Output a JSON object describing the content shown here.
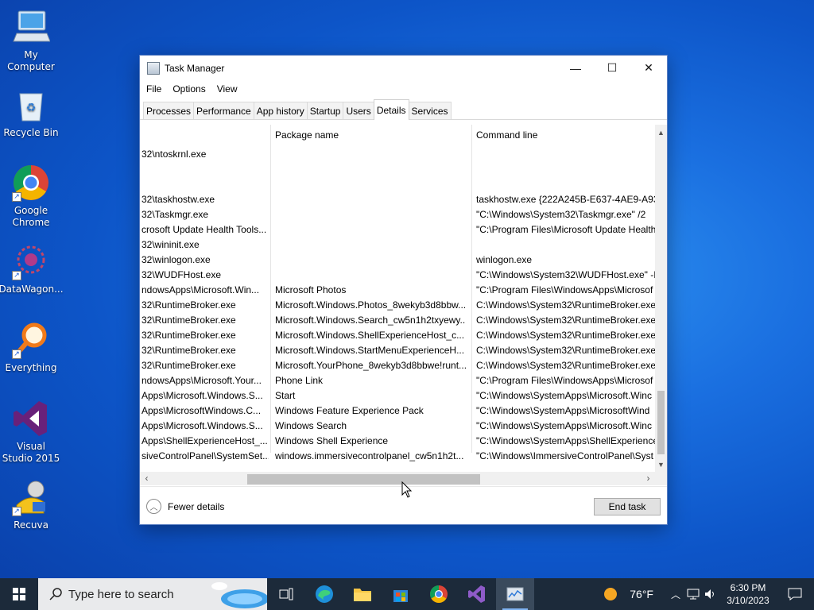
{
  "desktop": {
    "icons": [
      {
        "label": "My Computer"
      },
      {
        "label": "Recycle Bin"
      },
      {
        "label": "Google Chrome"
      },
      {
        "label": "DataWagon..."
      },
      {
        "label": "Everything"
      },
      {
        "label": "Visual Studio 2015"
      },
      {
        "label": "Recuva"
      }
    ]
  },
  "window": {
    "title": "Task Manager",
    "controls": {
      "minimize": "—",
      "maximize": "☐",
      "close": "✕"
    },
    "menu": [
      "File",
      "Options",
      "View"
    ],
    "tabs": [
      "Processes",
      "Performance",
      "App history",
      "Startup",
      "Users",
      "Details",
      "Services"
    ],
    "active_tab": "Details",
    "columns": [
      "",
      "Package name",
      "Command line"
    ],
    "rows": [
      {
        "path": "32\\ntoskrnl.exe",
        "package": "",
        "cmd": ""
      },
      {
        "path": "",
        "package": "",
        "cmd": ""
      },
      {
        "path": "",
        "package": "",
        "cmd": ""
      },
      {
        "path": "32\\taskhostw.exe",
        "package": "",
        "cmd": "taskhostw.exe {222A245B-E637-4AE9-A93F"
      },
      {
        "path": "32\\Taskmgr.exe",
        "package": "",
        "cmd": "\"C:\\Windows\\System32\\Taskmgr.exe\" /2"
      },
      {
        "path": "crosoft Update Health Tools...",
        "package": "",
        "cmd": "\"C:\\Program Files\\Microsoft Update Health"
      },
      {
        "path": "32\\wininit.exe",
        "package": "",
        "cmd": ""
      },
      {
        "path": "32\\winlogon.exe",
        "package": "",
        "cmd": "winlogon.exe"
      },
      {
        "path": "32\\WUDFHost.exe",
        "package": "",
        "cmd": "\"C:\\Windows\\System32\\WUDFHost.exe\" -I"
      },
      {
        "path": "ndowsApps\\Microsoft.Win...",
        "package": "Microsoft Photos",
        "cmd": "\"C:\\Program Files\\WindowsApps\\Microsof"
      },
      {
        "path": "32\\RuntimeBroker.exe",
        "package": "Microsoft.Windows.Photos_8wekyb3d8bbw...",
        "cmd": "C:\\Windows\\System32\\RuntimeBroker.exe"
      },
      {
        "path": "32\\RuntimeBroker.exe",
        "package": "Microsoft.Windows.Search_cw5n1h2txyewy...",
        "cmd": "C:\\Windows\\System32\\RuntimeBroker.exe"
      },
      {
        "path": "32\\RuntimeBroker.exe",
        "package": "Microsoft.Windows.ShellExperienceHost_c...",
        "cmd": "C:\\Windows\\System32\\RuntimeBroker.exe"
      },
      {
        "path": "32\\RuntimeBroker.exe",
        "package": "Microsoft.Windows.StartMenuExperienceH...",
        "cmd": "C:\\Windows\\System32\\RuntimeBroker.exe"
      },
      {
        "path": "32\\RuntimeBroker.exe",
        "package": "Microsoft.YourPhone_8wekyb3d8bbwe!runt...",
        "cmd": "C:\\Windows\\System32\\RuntimeBroker.exe"
      },
      {
        "path": "ndowsApps\\Microsoft.Your...",
        "package": "Phone Link",
        "cmd": "\"C:\\Program Files\\WindowsApps\\Microsof"
      },
      {
        "path": "Apps\\Microsoft.Windows.S...",
        "package": "Start",
        "cmd": "\"C:\\Windows\\SystemApps\\Microsoft.Winc"
      },
      {
        "path": "Apps\\MicrosoftWindows.C...",
        "package": "Windows Feature Experience Pack",
        "cmd": "\"C:\\Windows\\SystemApps\\MicrosoftWind"
      },
      {
        "path": "Apps\\Microsoft.Windows.S...",
        "package": "Windows Search",
        "cmd": "\"C:\\Windows\\SystemApps\\Microsoft.Winc"
      },
      {
        "path": "Apps\\ShellExperienceHost_...",
        "package": "Windows Shell Experience",
        "cmd": "\"C:\\Windows\\SystemApps\\ShellExperience"
      },
      {
        "path": "siveControlPanel\\SystemSet...",
        "package": "windows.immersivecontrolpanel_cw5n1h2t...",
        "cmd": "\"C:\\Windows\\ImmersiveControlPanel\\Syst"
      }
    ],
    "footer": {
      "fewer_details": "Fewer details",
      "end_task": "End task"
    }
  },
  "taskbar": {
    "search_placeholder": "Type here to search",
    "weather": "76°F",
    "time": "6:30 PM",
    "date": "3/10/2023"
  }
}
